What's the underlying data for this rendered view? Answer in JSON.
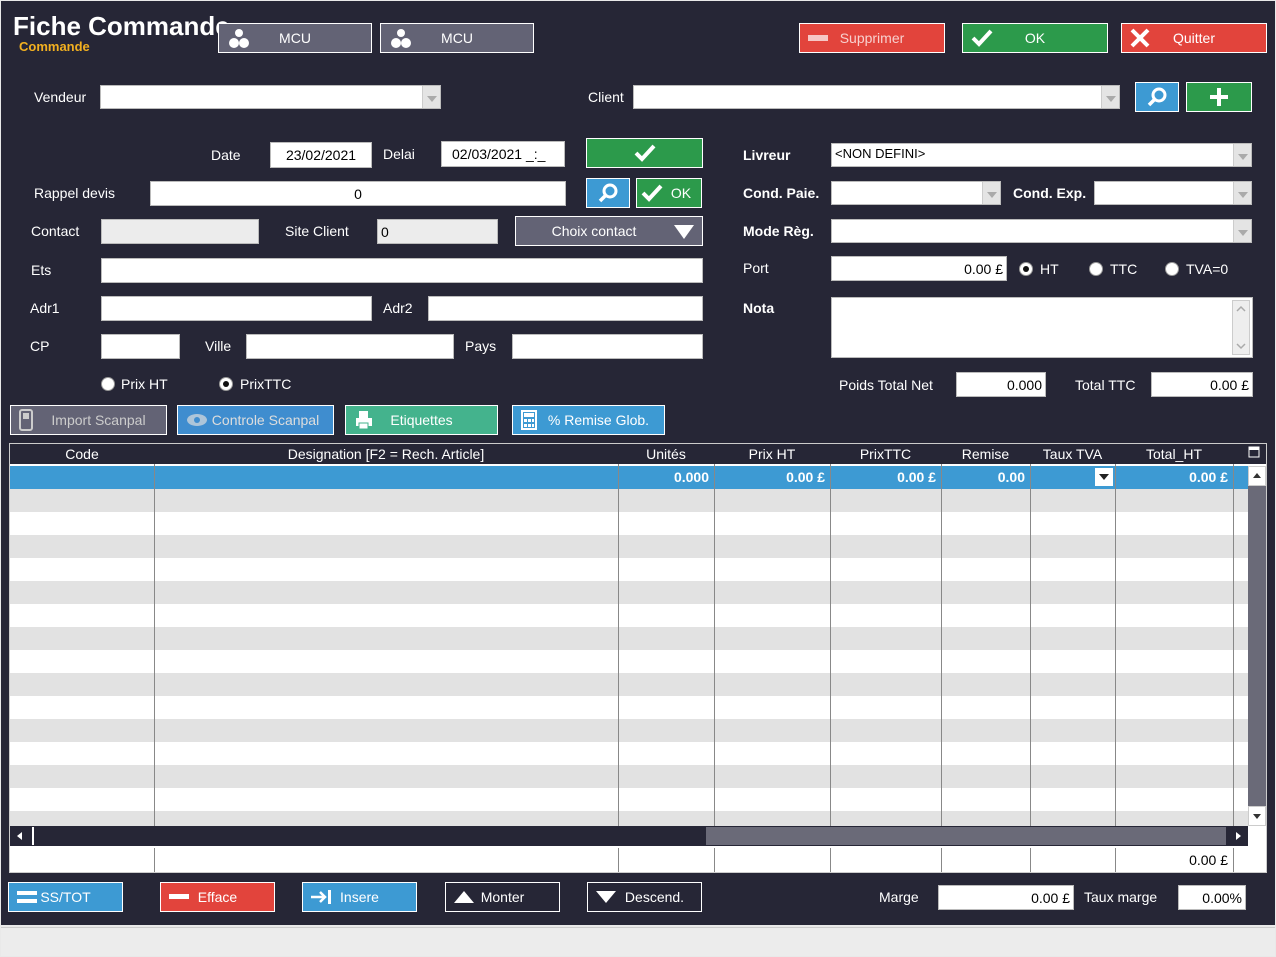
{
  "header": {
    "title": "Fiche Commande",
    "subtitle": "Commande",
    "mcu1": "MCU",
    "mcu2": "MCU",
    "delete_label": "Supprimer",
    "ok_label": "OK",
    "quit_label": "Quitter"
  },
  "form": {
    "vendeur_label": "Vendeur",
    "vendeur_value": "",
    "client_label": "Client",
    "client_value": "",
    "date_label": "Date",
    "date_value": "23/02/2021",
    "delai_label": "Delai",
    "delai_value": "02/03/2021 _:_",
    "rappel_label": "Rappel devis",
    "rappel_value": "0",
    "rappel_ok_label": "OK",
    "contact_label": "Contact",
    "contact_value": "",
    "site_client_label": "Site Client",
    "site_client_value": "0",
    "choix_contact_label": "Choix contact",
    "ets_label": "Ets",
    "ets_value": "",
    "adr1_label": "Adr1",
    "adr1_value": "",
    "adr2_label": "Adr2",
    "adr2_value": "",
    "cp_label": "CP",
    "cp_value": "",
    "ville_label": "Ville",
    "ville_value": "",
    "pays_label": "Pays",
    "pays_value": "",
    "prix_ht_label": "Prix HT",
    "prix_ttc_label": "PrixTTC",
    "prix_mode_selected": "PrixTTC"
  },
  "right_form": {
    "livreur_label": "Livreur",
    "livreur_value": "<NON DEFINI>",
    "cond_paie_label": "Cond. Paie.",
    "cond_paie_value": "",
    "cond_exp_label": "Cond. Exp.",
    "cond_exp_value": "",
    "mode_reg_label": "Mode Règ.",
    "mode_reg_value": "",
    "port_label": "Port",
    "port_value": "0.00 £",
    "ht_label": "HT",
    "ttc_label": "TTC",
    "tva0_label": "TVA=0",
    "port_mode_selected": "HT",
    "nota_label": "Nota",
    "nota_value": "",
    "poids_label": "Poids Total Net",
    "poids_value": "0.000",
    "total_ttc_label": "Total TTC",
    "total_ttc_value": "0.00 £"
  },
  "toolbar": {
    "import_scanpal": "Import Scanpal",
    "controle_scanpal": "Controle Scanpal",
    "etiquettes": "Etiquettes",
    "remise_glob": "% Remise Glob."
  },
  "grid": {
    "columns": [
      "Code",
      "Designation [F2 = Rech. Article]",
      "Unités",
      "Prix HT",
      "PrixTTC",
      "Remise",
      "Taux TVA",
      "Total_HT"
    ],
    "selected_row": {
      "code": "",
      "designation": "",
      "unites": "0.000",
      "prix_ht": "0.00 £",
      "prix_ttc": "0.00 £",
      "remise": "0.00",
      "taux_tva": "",
      "total_ht": "0.00 £"
    },
    "footer_total_ht": "0.00 £"
  },
  "bottom": {
    "sstot": "SS/TOT",
    "efface": "Efface",
    "insere": "Insere",
    "monter": "Monter",
    "descend": "Descend.",
    "marge_label": "Marge",
    "marge_value": "0.00 £",
    "taux_marge_label": "Taux marge",
    "taux_marge_value": "0.00%"
  },
  "colors": {
    "background": "#262636",
    "red": "#e2443c",
    "green": "#2c9a4b",
    "blue": "#3d9ad3",
    "teal": "#44b38d",
    "subtitle": "#f2b020"
  }
}
